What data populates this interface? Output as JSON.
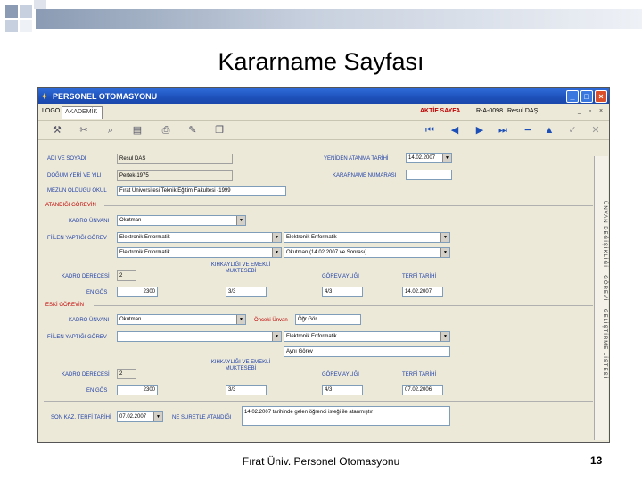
{
  "slide": {
    "title": "Kararname Sayfası",
    "footer": "Fırat Üniv. Personel Otomasyonu",
    "page_number": "13"
  },
  "window": {
    "title": "PERSONEL OTOMASYONU",
    "menu_logo": "LOGO",
    "menu_tab": "AKADEMİK",
    "active_label": "AKTİF SAYFA",
    "active_code": "R-A-0098",
    "active_name": "Resul DAŞ"
  },
  "form": {
    "ad_soyad_label": "ADI ve SOYADI",
    "ad_soyad": "Resul DAŞ",
    "dogum_label": "DOĞUM YERİ ve YILI",
    "dogum": "Pertek-1975",
    "mezun_label": "MEZUN OLDUĞU OKUL",
    "mezun": "Fırat Üniversitesi Teknik Eğitim Fakultesi -1999",
    "yeniden_label": "YENİDEN ATANMA TARİHİ",
    "yeniden": "14.02.2007",
    "kararname_no_label": "KARARNAME NUMARASI",
    "kararname_no": ""
  },
  "atandigi": {
    "section": "ATANDIĞI GÖREVİN",
    "kadro_label": "KADRO ÜNVANI",
    "kadro": "Okutman",
    "fiilen_label": "FİİLEN YAPTIĞI GÖREV",
    "fiilen_1": "Elektronik Enformatik",
    "fiilen_2": "Elektronik Enformatik",
    "fiilen_3": "Elektronik Enformatik",
    "fiilen_4": "Okutman (14.02.2007 ve Sonrası)",
    "derece_label": "KADRO DERECESİ",
    "derece": "2",
    "en_gos_label": "EN GÖS",
    "en_gos": "2300",
    "kik_label": "KIHKAYLIĞI ve EMEKLİ MUKTESEBİ",
    "kik": "3/3",
    "gorev_ayligi_label": "GÖREV AYLIĞI",
    "gorev_ayligi": "4/3",
    "terfi_label": "TERFİ TARİHİ",
    "terfi": "14.02.2007"
  },
  "eski": {
    "section": "ESKİ GÖREVİN",
    "kadro_label": "KADRO ÜNVANI",
    "kadro": "Okutman",
    "onceki_label": "Önceki Ünvan",
    "onceki": "Öğr.Gör.",
    "fiilen_label": "FİİLEN YAPTIĞI GÖREV",
    "fiilen_1": "",
    "fiilen_2": "Elektronik Enformatik",
    "fiilen_3": "Aynı Görev",
    "derece_label": "KADRO DERECESİ",
    "derece": "2",
    "en_gos_label": "EN GÖS",
    "en_gos": "2300",
    "kik_label": "KIHKAYLIĞI ve EMEKLİ MUKTESEBİ",
    "kik": "3/3",
    "gorev_ayligi_label": "GÖREV AYLIĞI",
    "gorev_ayligi": "4/3",
    "terfi_label": "TERFİ TARİHİ",
    "terfi": "07.02.2006"
  },
  "bottom": {
    "son_terfi_label": "SON KAZ. TERFİ TARİHİ",
    "son_terfi": "07.02.2007",
    "ne_suretle_label": "NE SURETLE ATANDIĞI",
    "ne_suretle": "14.02.2007 tarihinde gelen öğrenci isteği ile atanmıştır"
  },
  "side_tab": {
    "label": "ÜNVAN DEĞİŞİKLİĞİ - GÖREVİ - GELİŞTİRME LİSTESİ"
  },
  "colors": {
    "titlebar": "#1d4fb8",
    "label": "#1f3fa8",
    "section": "#c00000",
    "window_bg": "#ece9d8"
  }
}
